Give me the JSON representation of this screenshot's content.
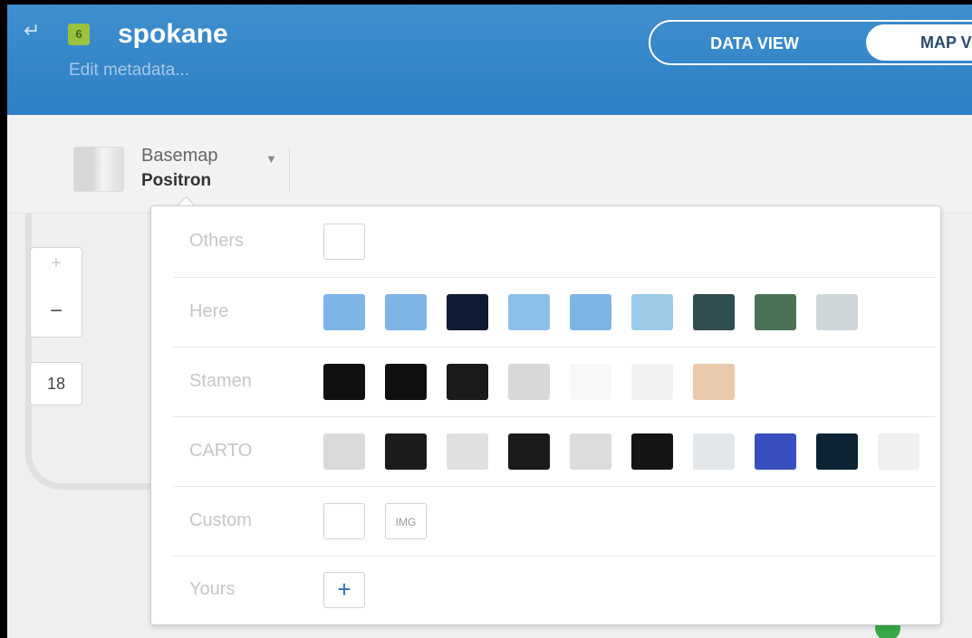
{
  "header": {
    "back_icon": "back-arrow-icon",
    "lock_badge": "6",
    "title": "spokane",
    "subtitle": "Edit metadata...",
    "tabs": [
      {
        "label": "DATA VIEW"
      },
      {
        "label": "MAP V"
      }
    ]
  },
  "basemap": {
    "label": "Basemap",
    "value": "Positron",
    "caret_icon": "caret-down-icon"
  },
  "zoom": {
    "in": "+",
    "out": "−",
    "level": "18"
  },
  "panel": {
    "rows": [
      {
        "label": "Others",
        "swatches": [
          {
            "type": "empty"
          }
        ]
      },
      {
        "label": "Here",
        "swatches": [
          {
            "bg": "#7fb5e6"
          },
          {
            "bg": "#7fb5e6"
          },
          {
            "bg": "#0f1a33"
          },
          {
            "bg": "#8cc0e8"
          },
          {
            "bg": "#7fb5e6"
          },
          {
            "bg": "#9ccbe8"
          },
          {
            "bg": "#2f4d4f"
          },
          {
            "bg": "#4a7356"
          },
          {
            "bg": "#cfd6da"
          }
        ]
      },
      {
        "label": "Stamen",
        "swatches": [
          {
            "bg": "#101010"
          },
          {
            "bg": "#101010"
          },
          {
            "bg": "#1a1a1a"
          },
          {
            "bg": "#d8d8d8"
          },
          {
            "bg": "#f7f7f7"
          },
          {
            "bg": "#f2f2f2"
          },
          {
            "bg": "#e9c9ac"
          }
        ]
      },
      {
        "label": "CARTO",
        "swatches": [
          {
            "bg": "#d9d9d9"
          },
          {
            "bg": "#1b1b1b"
          },
          {
            "bg": "#e0e0e0"
          },
          {
            "bg": "#1a1a1a"
          },
          {
            "bg": "#dcdcdc"
          },
          {
            "bg": "#151515"
          },
          {
            "bg": "#e3e7ea"
          },
          {
            "bg": "#3a4fbf"
          },
          {
            "bg": "#0c2333"
          },
          {
            "bg": "#f0f0f0"
          }
        ]
      },
      {
        "label": "Custom",
        "swatches": [
          {
            "type": "empty"
          },
          {
            "type": "img",
            "text": "IMG"
          }
        ]
      },
      {
        "label": "Yours",
        "swatches": [
          {
            "type": "add",
            "text": "+"
          }
        ]
      }
    ]
  },
  "colors": {
    "header": "#3589c9",
    "accent": "#2e6fb5",
    "badge": "#9bc23f"
  }
}
